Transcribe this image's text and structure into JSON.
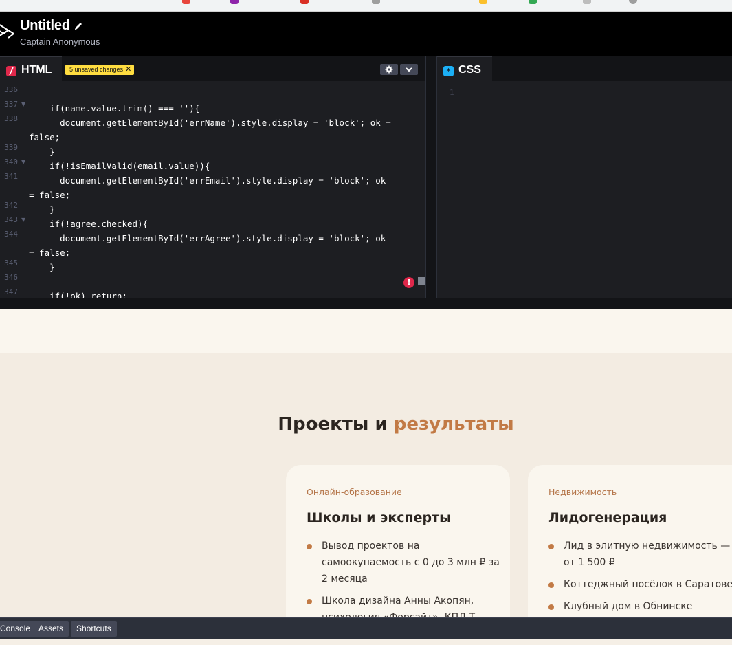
{
  "header": {
    "title": "Untitled",
    "author": "Captain Anonymous"
  },
  "html_editor": {
    "tab_label": "HTML",
    "unsaved_badge": "5 unsaved changes",
    "line_numbers": [
      "336",
      "337",
      "338",
      "339",
      "340",
      "341",
      "342",
      "343",
      "344",
      "345",
      "346",
      "347"
    ],
    "code_lines": [
      {
        "ln": "336",
        "text": ""
      },
      {
        "ln": "337",
        "text": "    if(name.value.trim() === ''){"
      },
      {
        "ln": "338",
        "text": "      document.getElementById('errName').style.display = 'block'; ok ="
      },
      {
        "ln": "",
        "text": "false;"
      },
      {
        "ln": "339",
        "text": "    }"
      },
      {
        "ln": "340",
        "text": "    if(!isEmailValid(email.value)){"
      },
      {
        "ln": "341",
        "text": "      document.getElementById('errEmail').style.display = 'block'; ok"
      },
      {
        "ln": "",
        "text": "= false;"
      },
      {
        "ln": "342",
        "text": "    }"
      },
      {
        "ln": "343",
        "text": "    if(!agree.checked){"
      },
      {
        "ln": "344",
        "text": "      document.getElementById('errAgree').style.display = 'block'; ok"
      },
      {
        "ln": "",
        "text": "= false;"
      },
      {
        "ln": "345",
        "text": "    }"
      },
      {
        "ln": "346",
        "text": ""
      },
      {
        "ln": "347",
        "text": "    if(!ok) return;"
      }
    ],
    "error_marker": "!"
  },
  "css_editor": {
    "tab_label": "CSS",
    "line_number": "1"
  },
  "preview": {
    "section_title_main": "Проекты и ",
    "section_title_accent": "результаты",
    "cards": [
      {
        "category": "Онлайн-образование",
        "title": "Школы и эксперты",
        "items": [
          "Вывод проектов на самоокупаемость с 0 до 3 млн ₽ за 2 месяца",
          "Школа дизайна Анны Акопян, психология «Форсайт», КПД Т..."
        ]
      },
      {
        "category": "Недвижимость",
        "title": "Лидогенерация",
        "items": [
          "Лид в элитную недвижимость — от 1 500 ₽",
          "Коттеджный посёлок в Саратове",
          "Клубный дом в Обнинске"
        ]
      }
    ]
  },
  "bottom_bar": {
    "console_label": "Console",
    "assets_label": "Assets",
    "shortcuts_label": "Shortcuts"
  },
  "colors": {
    "accent": "#c27a45",
    "badge": "#ffdd40",
    "html_icon": "#e0284b",
    "css_icon": "#1cb0f6"
  }
}
